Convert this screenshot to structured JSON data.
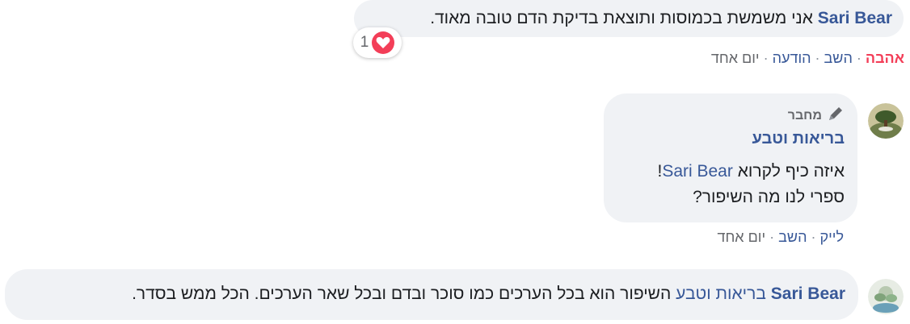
{
  "comments": [
    {
      "author": "Sari Bear",
      "text": "אני משמשת בכמוסות ותוצאת בדיקת הדם טובה מאוד.",
      "reaction_icon": "heart-icon",
      "reaction_count": "1",
      "actions": {
        "love": "אהבה",
        "reply": "השב",
        "message": "הודעה",
        "time": "יום אחד"
      }
    },
    {
      "badge_icon": "pencil-icon",
      "badge": "מחבר",
      "author": "בריאות וטבע",
      "line1_text": "איזה כיף לקרוא",
      "line1_mention": "Sari Bear",
      "line1_end": "!",
      "line2": "ספרי לנו מה השיפור?",
      "actions": {
        "like": "לייק",
        "reply": "השב",
        "time": "יום אחד"
      }
    },
    {
      "author": "Sari Bear",
      "mention": "בריאות וטבע",
      "text": "השיפור הוא בכל הערכים כמו סוכר ובדם ובכל שאר הערכים. הכל ממש בסדר."
    }
  ],
  "colors": {
    "link": "#385898",
    "love": "#f33e58",
    "bubble": "#f0f2f5",
    "meta": "#65676b"
  }
}
